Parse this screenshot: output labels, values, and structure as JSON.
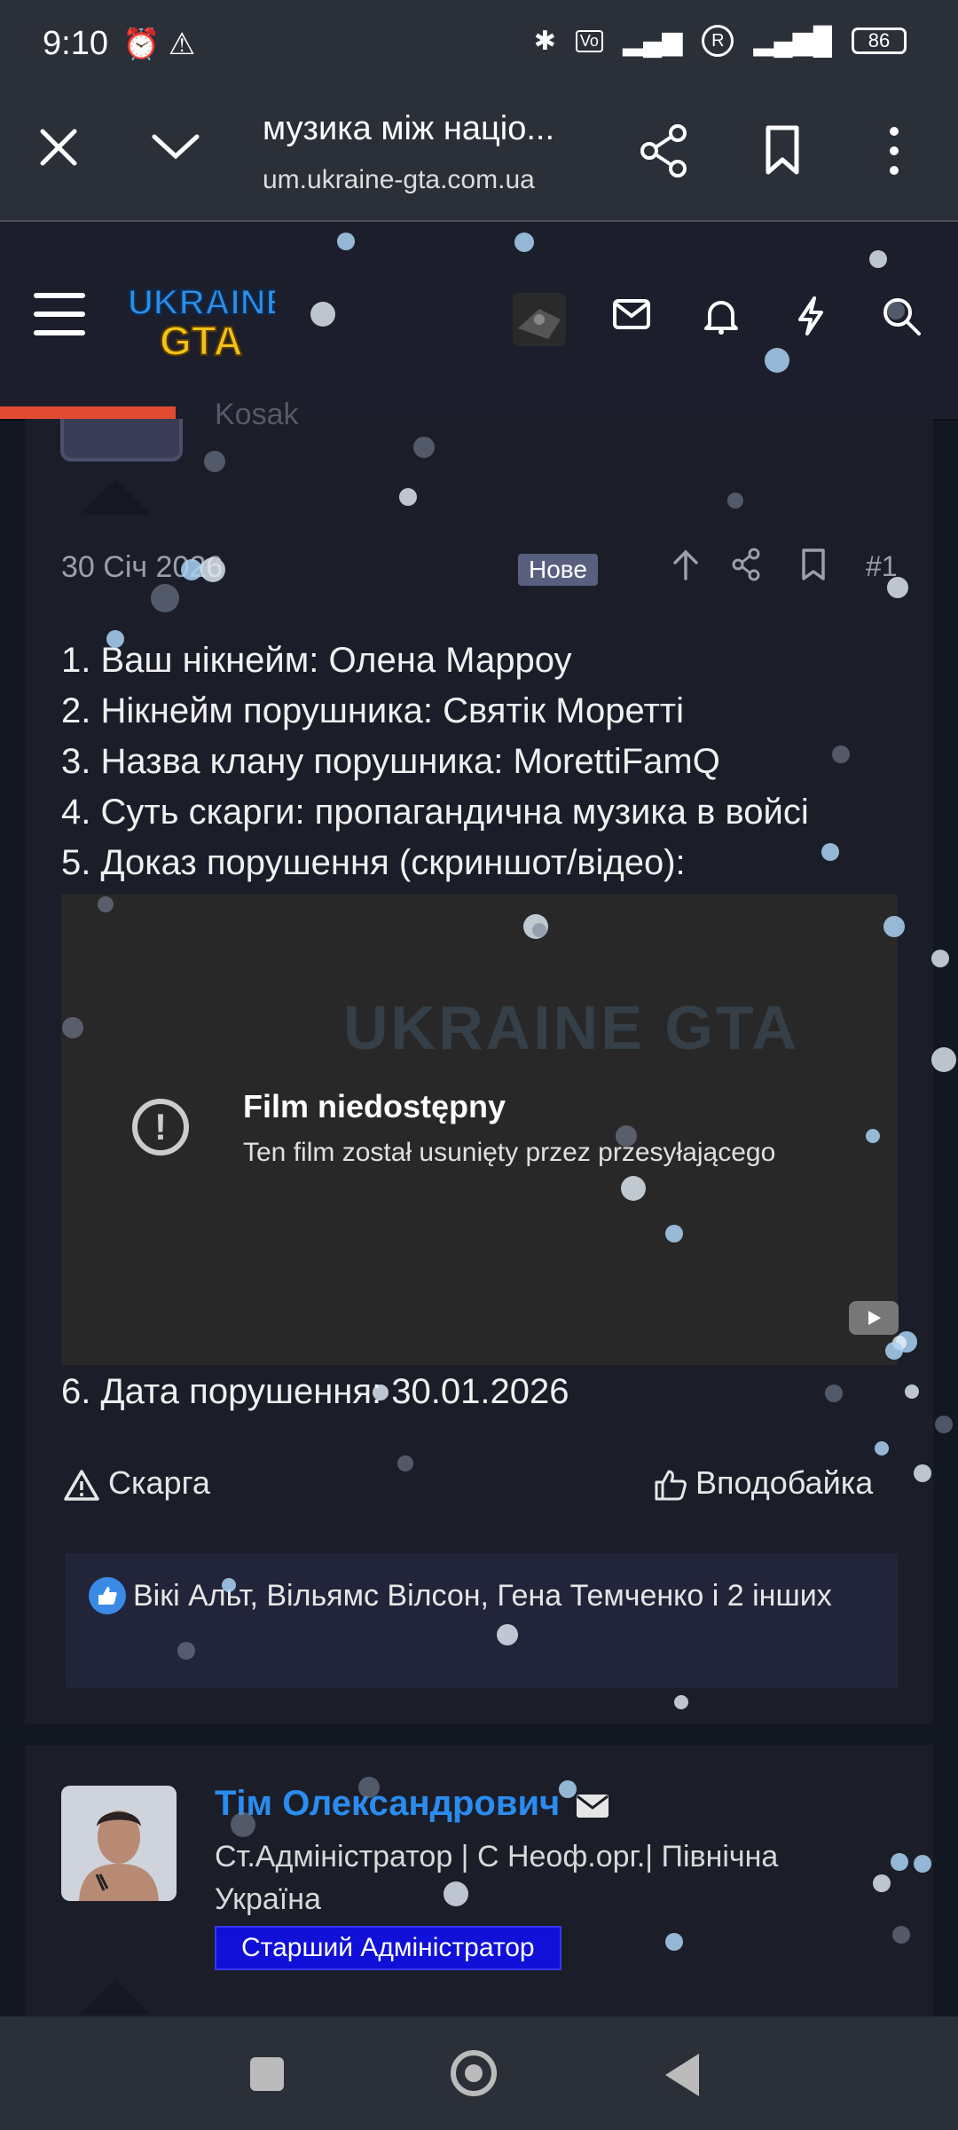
{
  "status_bar": {
    "time": "9:10",
    "battery": "86",
    "icons": [
      "alarm-icon",
      "warning-icon",
      "bluetooth-icon",
      "volte-icon",
      "signal-icon",
      "roaming-icon",
      "signal-icon",
      "battery-icon"
    ]
  },
  "browser": {
    "page_title": "музика між націо...",
    "url": "um.ukraine-gta.com.ua"
  },
  "site_header": {
    "logo_text": "UKRAINE GTA"
  },
  "previous_post": {
    "username_fragment": "Kosak"
  },
  "post": {
    "date": "30 Січ 2026",
    "badge": "Нове",
    "number": "#1",
    "lines": {
      "l1": "1. Ваш нікнейм: Олена Марроу",
      "l2": "2. Нікнейм порушника: Святік Моретті",
      "l3": "3. Назва клану порушника: MorettiFamQ",
      "l4": "4. Суть скарги: пропагандична музика в войсі",
      "l5": "5. Доказ порушення (скриншот/відео):",
      "l6": "6. Дата порушення: 30.01.2026"
    },
    "video": {
      "title": "Film niedostępny",
      "subtitle": "Ten film został usunięty przez przesyłającego",
      "watermark": "UKRAINE GTA"
    },
    "report_label": "Скарга",
    "like_label": "Вподобайка",
    "reactions_text": "Вікі Альт, Вільямс Вілсон, Гена Темченко і 2 інших"
  },
  "next_post": {
    "author_name": "Тім Олександрович",
    "author_role": "Ст.Адміністратор | С Неоф.орг.| Північна Україна",
    "author_badge": "Старший Адміністратор"
  },
  "colors": {
    "accent_progress": "#e14b32",
    "author_name": "#2b8cf0",
    "badge_bg": "#1010d8",
    "new_badge_bg": "#59607f"
  }
}
